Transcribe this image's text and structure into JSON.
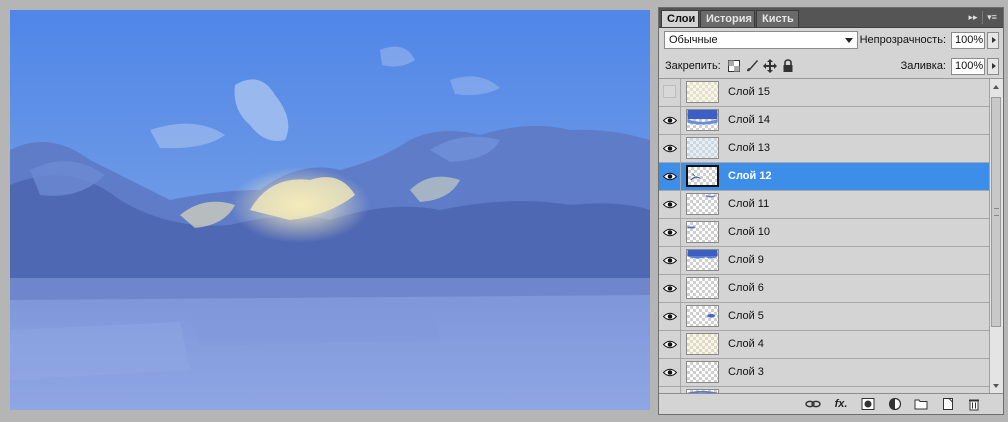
{
  "panel": {
    "tabs": [
      {
        "label": "Слои",
        "active": true
      },
      {
        "label": "История",
        "active": false
      },
      {
        "label": "Кисть",
        "active": false
      }
    ],
    "collapse_glyph": "▸▸",
    "menu_glyph": "▾≡"
  },
  "controls": {
    "blend_mode": "Обычные",
    "opacity_label": "Непрозрачность:",
    "opacity_value": "100%",
    "lock_label": "Закрепить:",
    "fill_label": "Заливка:",
    "fill_value": "100%"
  },
  "layers": [
    {
      "name": "Слой 15",
      "visible": false,
      "selected": false
    },
    {
      "name": "Слой 14",
      "visible": true,
      "selected": false
    },
    {
      "name": "Слой 13",
      "visible": true,
      "selected": false
    },
    {
      "name": "Слой 12",
      "visible": true,
      "selected": true
    },
    {
      "name": "Слой 11",
      "visible": true,
      "selected": false
    },
    {
      "name": "Слой 10",
      "visible": true,
      "selected": false
    },
    {
      "name": "Слой 9",
      "visible": true,
      "selected": false
    },
    {
      "name": "Слой 6",
      "visible": true,
      "selected": false
    },
    {
      "name": "Слой 5",
      "visible": true,
      "selected": false
    },
    {
      "name": "Слой 4",
      "visible": true,
      "selected": false
    },
    {
      "name": "Слой 3",
      "visible": true,
      "selected": false
    },
    {
      "name": "",
      "visible": true,
      "selected": false
    }
  ],
  "footer": {
    "fx_label": "fx."
  },
  "colors": {
    "selection": "#3d8ee8",
    "panel_bg": "#d4d4d4",
    "tabbar_bg": "#555555",
    "sky": "#6a93e0"
  }
}
